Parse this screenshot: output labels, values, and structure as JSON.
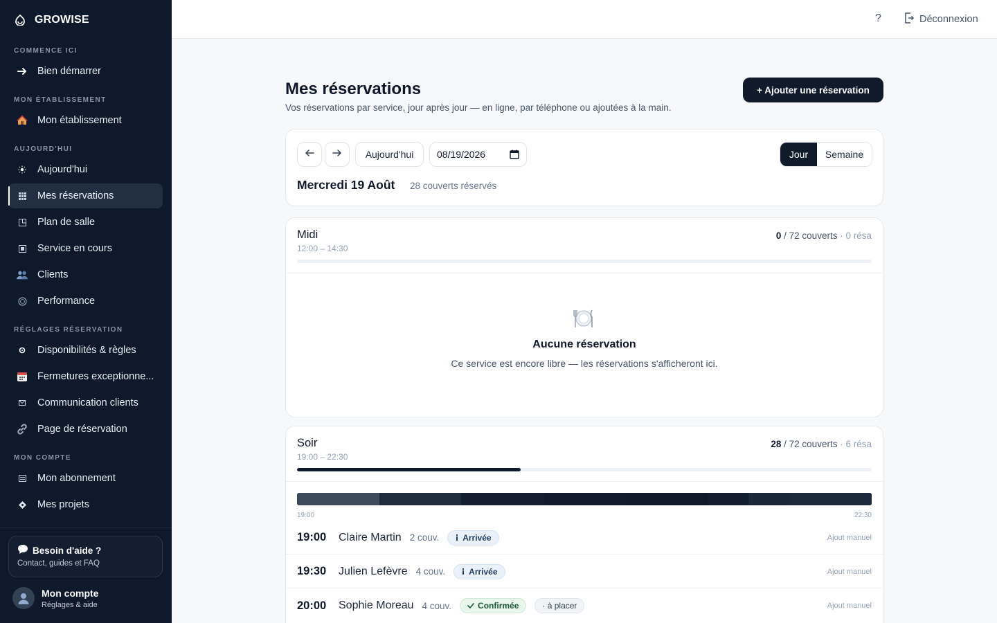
{
  "app": {
    "name": "GROWISE"
  },
  "sidebar": {
    "sections": [
      {
        "title": "COMMENCE ICI",
        "items": [
          {
            "label": "Bien démarrer",
            "icon": "arrow-right-icon"
          }
        ]
      },
      {
        "title": "MON ÉTABLISSEMENT",
        "items": [
          {
            "label": "Mon établissement",
            "icon": "house-icon"
          }
        ]
      },
      {
        "title": "AUJOURD'HUI",
        "items": [
          {
            "label": "Aujourd'hui",
            "icon": "sun-icon"
          },
          {
            "label": "Mes réservations",
            "icon": "grid-icon",
            "active": true
          },
          {
            "label": "Plan de salle",
            "icon": "floorplan-icon"
          },
          {
            "label": "Service en cours",
            "icon": "square-icon"
          },
          {
            "label": "Clients",
            "icon": "users-icon"
          },
          {
            "label": "Performance",
            "icon": "circle-icon"
          }
        ]
      },
      {
        "title": "RÉGLAGES RÉSERVATION",
        "items": [
          {
            "label": "Disponibilités & règles",
            "icon": "gear-icon"
          },
          {
            "label": "Fermetures exceptionne...",
            "icon": "calendar-icon"
          },
          {
            "label": "Communication clients",
            "icon": "mail-icon"
          },
          {
            "label": "Page de réservation",
            "icon": "link-icon"
          }
        ]
      },
      {
        "title": "MON COMPTE",
        "items": [
          {
            "label": "Mon abonnement",
            "icon": "list-icon"
          },
          {
            "label": "Mes projets",
            "icon": "diamond-icon"
          }
        ]
      }
    ],
    "help": {
      "title": "Besoin d'aide ?",
      "subtitle": "Contact, guides et FAQ"
    },
    "account": {
      "name": "Mon compte",
      "subtitle": "Réglages & aide"
    }
  },
  "topbar": {
    "help": "?",
    "logout": "Déconnexion"
  },
  "main": {
    "title": "Mes réservations",
    "subtitle": "Vos réservations par service, jour après jour — en ligne, par téléphone ou ajoutées à la main.",
    "add_button": "+ Ajouter une réservation",
    "nav": {
      "today": "Aujourd'hui",
      "date": "08/19/2026",
      "view_day": "Jour",
      "view_week": "Semaine",
      "day_title": "Mercredi 19 Août",
      "day_covers": "28 couverts réservés"
    },
    "services": {
      "midi": {
        "name": "Midi",
        "time": "12:00 – 14:30",
        "booked": "0",
        "capacity_text": "/ 72 couverts",
        "resa_text": "· 0 résa",
        "fill": 0,
        "empty_title": "Aucune réservation",
        "empty_desc": "Ce service est encore libre — les réservations s'afficheront ici."
      },
      "soir": {
        "name": "Soir",
        "time": "19:00 – 22:30",
        "booked": "28",
        "capacity_text": "/ 72 couverts",
        "resa_text": "· 6 résa",
        "fill": 0.389,
        "timeline_start": "19:00",
        "timeline_end": "22:30",
        "reservations": [
          {
            "time": "19:00",
            "name": "Claire Martin",
            "covers": "2 couv.",
            "status": "Arrivée",
            "status_type": "arrived",
            "source": "Ajout manuel"
          },
          {
            "time": "19:30",
            "name": "Julien Lefèvre",
            "covers": "4 couv.",
            "status": "Arrivée",
            "status_type": "arrived",
            "source": "Ajout manuel"
          },
          {
            "time": "20:00",
            "name": "Sophie Moreau",
            "covers": "4 couv.",
            "status": "Confirmée",
            "status_type": "confirmed",
            "extra": "· à placer",
            "source": "Ajout manuel"
          }
        ]
      }
    }
  },
  "colors": {
    "sidebar": "#0e1a2b",
    "primary": "#0f1a2b",
    "accent_bg": "#f7f8fa"
  }
}
